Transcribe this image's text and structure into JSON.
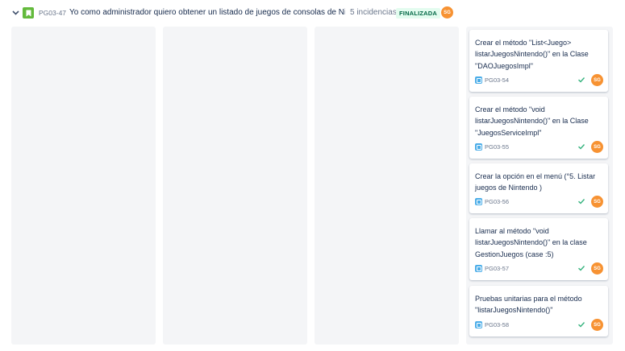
{
  "epic": {
    "key": "PG03-47",
    "title": "Yo como administrador quiero obtener un listado de juegos de consolas de Ninte...",
    "count": "5 incidencias",
    "status": "FINALIZADA",
    "assignee": "SG"
  },
  "colors": {
    "column_bg": "#f4f5f7",
    "story_icon": "#63ba3c",
    "subtask_icon": "#4bade8",
    "avatar": "#f79232",
    "done_badge_bg": "#e3fcef",
    "done_badge_text": "#006644",
    "check": "#36b37e"
  },
  "icons": {
    "expand": "chevron-down-icon",
    "story": "bookmark-icon",
    "subtask": "subtask-icon",
    "done": "check-icon"
  },
  "cards": [
    {
      "title": "Crear el método \"List<Juego> listarJuegosNintendo()\" en la Clase \"DAOJuegosImpl\"",
      "key": "PG03-54",
      "assignee": "SG"
    },
    {
      "title": "Crear el método \"void listarJuegosNintendo()\" en la Clase \"JuegosServiceImpl\"",
      "key": "PG03-55",
      "assignee": "SG"
    },
    {
      "title": "Crear la opción en el menú (°5. Listar juegos de Nintendo )",
      "key": "PG03-56",
      "assignee": "SG"
    },
    {
      "title": "Llamar al método \"void listarJuegosNintendo()\" en la clase GestionJuegos (case :5)",
      "key": "PG03-57",
      "assignee": "SG"
    },
    {
      "title": "Pruebas unitarias para el método \"listarJuegosNintendo()\"",
      "key": "PG03-58",
      "assignee": "SG"
    }
  ]
}
